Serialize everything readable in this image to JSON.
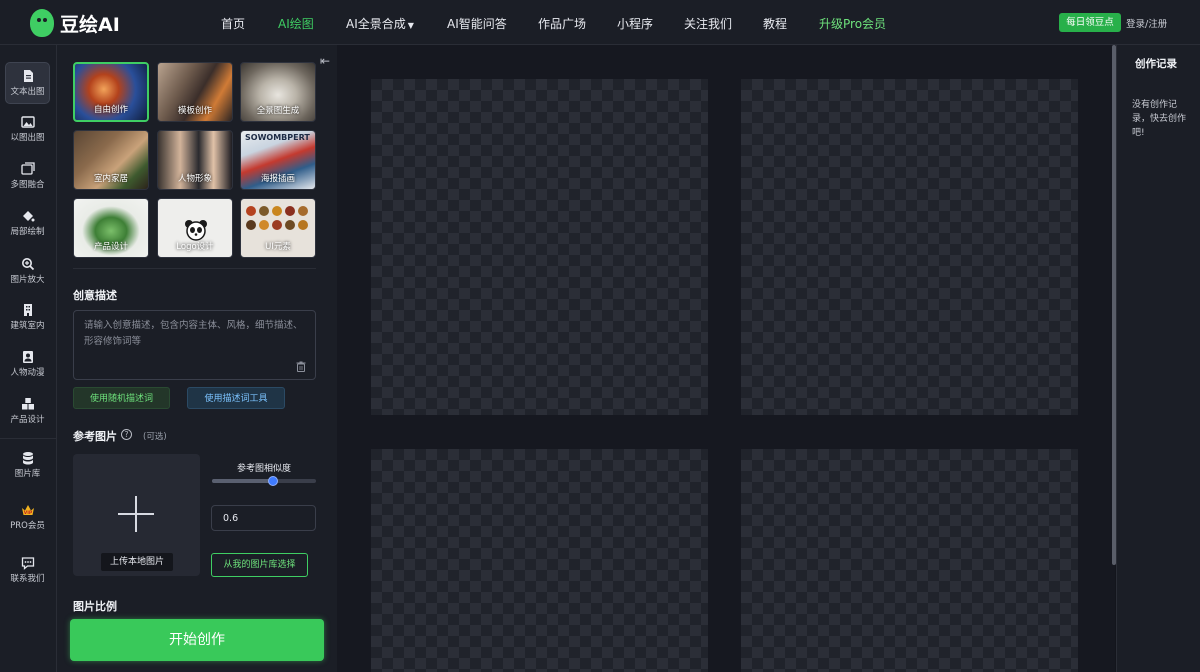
{
  "brand": {
    "name": "豆绘AI",
    "accent": "#3fce63"
  },
  "nav": {
    "items": [
      {
        "label": "首页",
        "active": false
      },
      {
        "label": "AI绘图",
        "active": true
      },
      {
        "label": "AI全景合成",
        "has_dropdown": true
      },
      {
        "label": "AI智能问答"
      },
      {
        "label": "作品广场"
      },
      {
        "label": "小程序"
      },
      {
        "label": "关注我们"
      },
      {
        "label": "教程"
      },
      {
        "label": "升级Pro会员",
        "highlight": true
      }
    ],
    "daily_button": "每日领豆点",
    "login": "登录/注册"
  },
  "sidebar": {
    "items": [
      {
        "label": "文本出图",
        "icon": "document-icon",
        "active": true
      },
      {
        "label": "以图出图",
        "icon": "image-icon"
      },
      {
        "label": "多图融合",
        "icon": "images-icon"
      },
      {
        "label": "局部绘制",
        "icon": "paint-bucket-icon"
      },
      {
        "label": "图片放大",
        "icon": "zoom-in-icon"
      },
      {
        "label": "建筑室内",
        "icon": "building-icon"
      },
      {
        "label": "人物动漫",
        "icon": "portrait-icon"
      },
      {
        "label": "产品设计",
        "icon": "boxes-icon"
      },
      {
        "label": "图片库",
        "icon": "database-icon"
      },
      {
        "label": "PRO会员",
        "icon": "vip-crown-icon"
      },
      {
        "label": "联系我们",
        "icon": "chat-icon"
      }
    ]
  },
  "templates": [
    {
      "label": "自由创作",
      "selected": true
    },
    {
      "label": "模板创作"
    },
    {
      "label": "全景图生成"
    },
    {
      "label": "室内家居"
    },
    {
      "label": "人物形象"
    },
    {
      "label": "海报插画",
      "image_text": "SOWOMBPERT"
    },
    {
      "label": "产品设计"
    },
    {
      "label": "Logo设计"
    },
    {
      "label": "UI元素"
    }
  ],
  "description": {
    "title": "创意描述",
    "placeholder": "请输入创意描述，包含内容主体、风格，细节描述、形容修饰词等",
    "random_button": "使用随机描述词",
    "tool_button": "使用描述词工具"
  },
  "reference": {
    "title": "参考图片",
    "optional": "(可选)",
    "upload_label": "上传本地图片",
    "similarity_label": "参考图相似度",
    "similarity_value": "0.6",
    "library_button": "从我的图片库选择"
  },
  "ratio": {
    "title": "图片比例"
  },
  "start_button": "开始创作",
  "history": {
    "title": "创作记录",
    "empty": "没有创作记录，快去创作吧!"
  }
}
